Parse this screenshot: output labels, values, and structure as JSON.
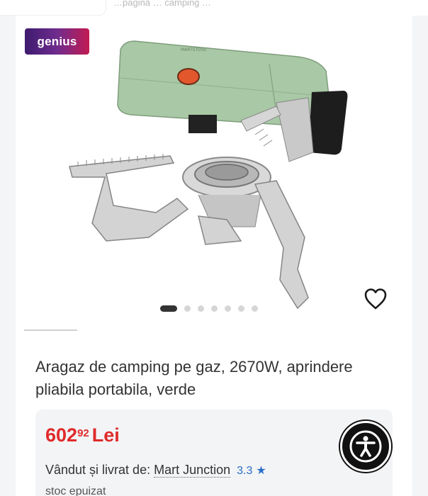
{
  "header": {
    "partial_text": "…pagină … camping …"
  },
  "gallery": {
    "badge": "genius",
    "dots_total": 7,
    "dots_active_index": 0
  },
  "product": {
    "title": "Aragaz de camping pe gaz, 2670W, aprindere pliabila portabila, verde",
    "price_int": "602",
    "price_dec": "92",
    "currency": "Lei",
    "seller_prefix": "Vândut și livrat de:",
    "seller_name": "Mart Junction",
    "rating": "3.3",
    "stock": "stoc epuizat"
  },
  "icons": {
    "favorite": "heart-outline-icon",
    "rating_star": "star-icon",
    "accessibility": "accessibility-icon"
  },
  "colors": {
    "price": "#e02a2a",
    "rating": "#2a6fc9",
    "stove_body": "#a8c8a4"
  }
}
